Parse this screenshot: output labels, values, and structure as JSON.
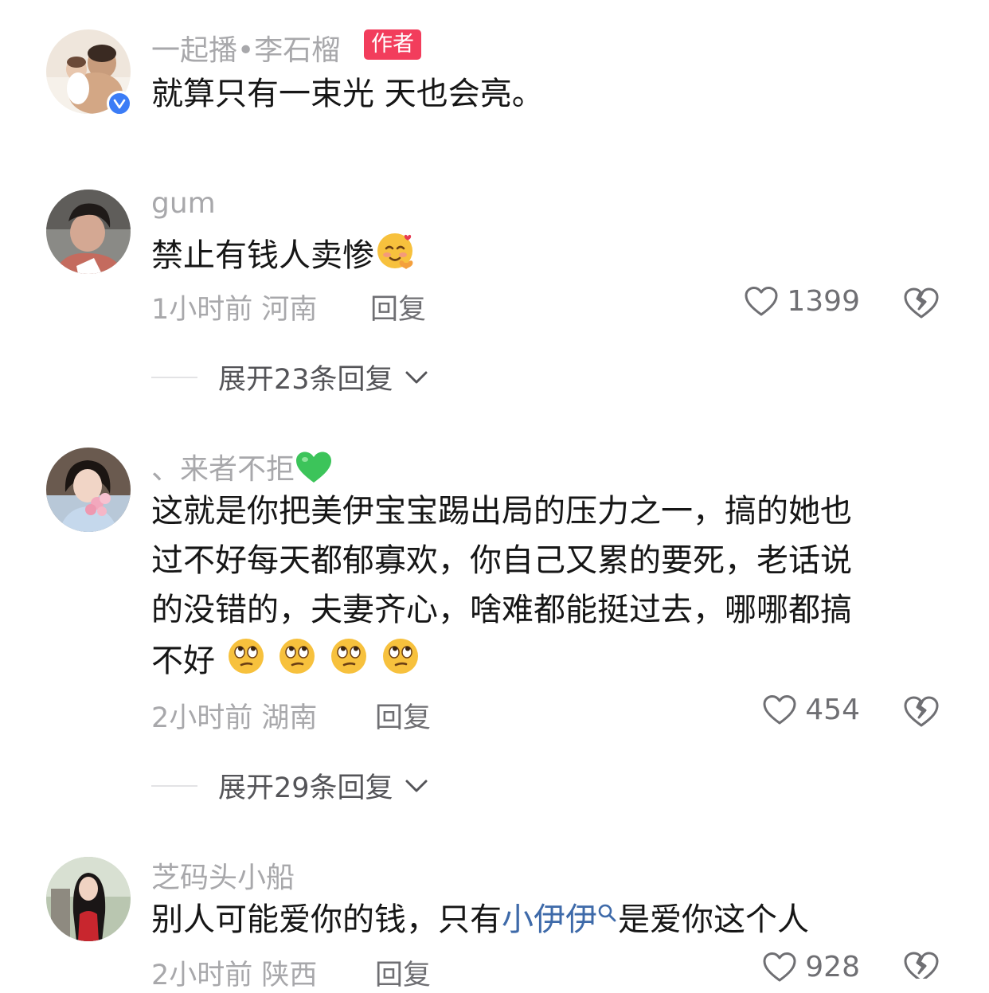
{
  "comments": [
    {
      "username": "一起播•李石榴",
      "badge": "作者",
      "text_lines": [
        "就算只有一束光 天也会亮。"
      ]
    },
    {
      "username": "gum",
      "text_lines": [
        "禁止有钱人卖惨"
      ],
      "emoji": "smiling-face-with-hearts",
      "time": "1小时前",
      "location": "河南",
      "reply_label": "回复",
      "likes": "1399",
      "expand_label": "展开23条回复"
    },
    {
      "username": "、来者不拒",
      "username_emoji": "green-heart",
      "text_lines": [
        "这就是你把美伊宝宝踢出局的压力之一，搞的她也",
        "过不好每天都郁寡欢，你自己又累的要死，老话说",
        "的没错的，夫妻齐心，啥难都能挺过去，哪哪都搞",
        "不好"
      ],
      "emoji": "face-with-rolling-eyes ×4",
      "time": "2小时前",
      "location": "湖南",
      "reply_label": "回复",
      "likes": "454",
      "expand_label": "展开29条回复"
    },
    {
      "username": "芝码头小船",
      "text_before": "别人可能爱你的钱，只有",
      "link_text": "小伊伊",
      "text_after": "是爱你这个人",
      "time": "2小时前",
      "location": "陕西",
      "reply_label": "回复",
      "likes": "928"
    }
  ],
  "colors": {
    "username": "#a8a8ab",
    "body_text": "#161616",
    "author_badge": "#f23d5c",
    "link": "#3e6aa9",
    "verified": "#3b7cf6"
  }
}
